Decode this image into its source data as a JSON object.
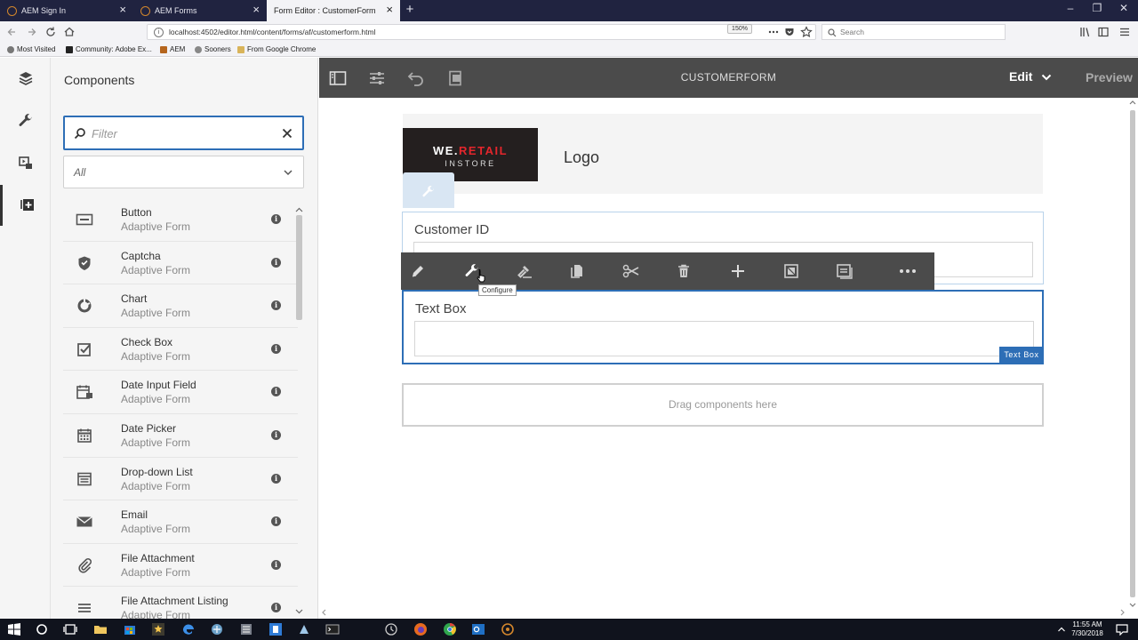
{
  "browser": {
    "tabs": [
      {
        "title": "AEM Sign In",
        "active": false
      },
      {
        "title": "AEM Forms",
        "active": false
      },
      {
        "title": "Form Editor : CustomerForm",
        "active": true
      }
    ],
    "url": "localhost:4502/editor.html/content/forms/af/customerform.html",
    "zoom": "150%",
    "search_placeholder": "Search",
    "bookmarks": [
      "Most Visited",
      "Community: Adobe Ex...",
      "AEM",
      "Sooners",
      "From Google Chrome"
    ]
  },
  "panel": {
    "title": "Components",
    "filter_placeholder": "Filter",
    "group_selected": "All",
    "components": [
      {
        "name": "Button",
        "group": "Adaptive Form",
        "icon": "button-icon"
      },
      {
        "name": "Captcha",
        "group": "Adaptive Form",
        "icon": "shield-icon"
      },
      {
        "name": "Chart",
        "group": "Adaptive Form",
        "icon": "chart-icon"
      },
      {
        "name": "Check Box",
        "group": "Adaptive Form",
        "icon": "checkbox-icon"
      },
      {
        "name": "Date Input Field",
        "group": "Adaptive Form",
        "icon": "calendar-icon"
      },
      {
        "name": "Date Picker",
        "group": "Adaptive Form",
        "icon": "calendar-grid-icon"
      },
      {
        "name": "Drop-down List",
        "group": "Adaptive Form",
        "icon": "list-icon"
      },
      {
        "name": "Email",
        "group": "Adaptive Form",
        "icon": "envelope-icon"
      },
      {
        "name": "File Attachment",
        "group": "Adaptive Form",
        "icon": "paperclip-icon"
      },
      {
        "name": "File Attachment Listing",
        "group": "Adaptive Form",
        "icon": "list-icon"
      }
    ]
  },
  "editor": {
    "page_title": "CUSTOMERFORM",
    "mode_label": "Edit",
    "preview_label": "Preview"
  },
  "canvas": {
    "logo_line1_a": "WE.",
    "logo_line1_b": "RETAIL",
    "logo_line2": "INSTORE",
    "logo_label": "Logo",
    "customer_id_label": "Customer ID",
    "textbox_label": "Text Box",
    "textbox_badge": "Text Box",
    "dropzone_text": "Drag components here"
  },
  "component_toolbar": {
    "tooltip": "Configure",
    "actions": [
      "pencil-icon",
      "wrench-icon",
      "hammer-icon",
      "copy-icon",
      "scissors-icon",
      "trash-icon",
      "plus-icon",
      "frame-icon",
      "panel-icon",
      "more-icon"
    ]
  },
  "taskbar": {
    "time": "11:55 AM",
    "date": "7/30/2018"
  },
  "colors": {
    "accent": "#2d6eb6",
    "toolbar_bg": "#4b4b4b",
    "panel_bg": "#f5f5f5",
    "brand_red": "#e4262c"
  }
}
